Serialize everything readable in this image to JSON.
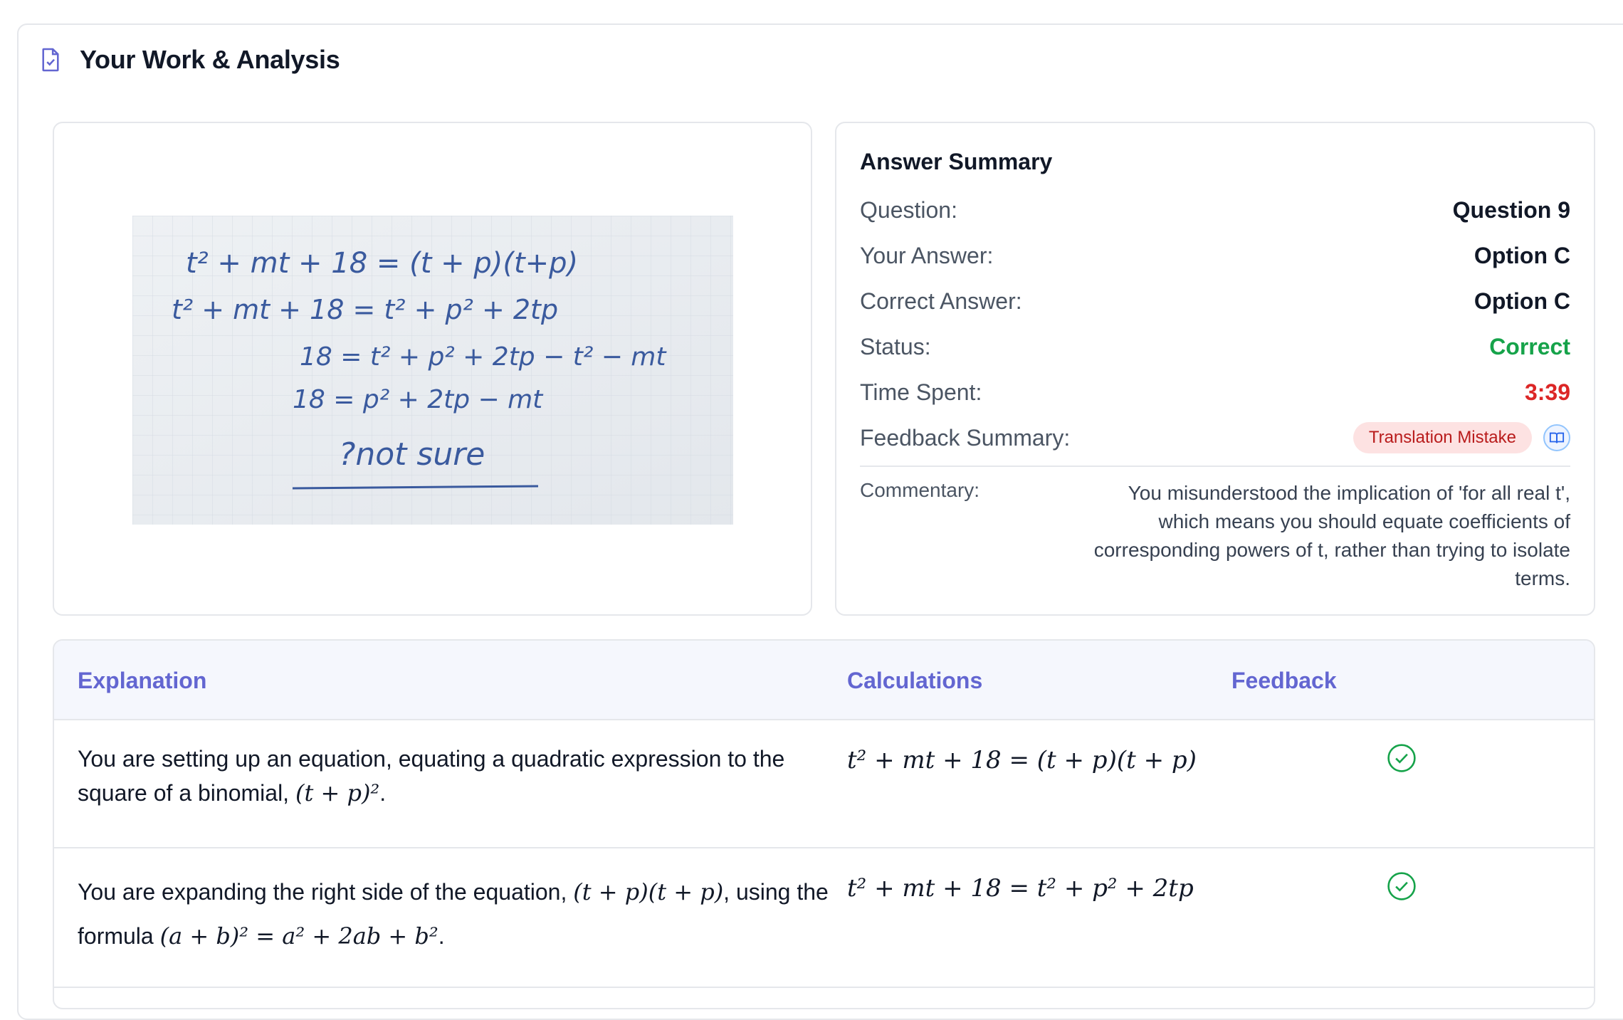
{
  "header": {
    "title": "Your Work & Analysis",
    "icon": "document-check-icon"
  },
  "work": {
    "image_alt": "Handwritten work photo",
    "handwriting": {
      "line1": "t² + mt + 18 = (t + p)(t+p)",
      "line2": "t² + mt + 18 = t² + p² + 2tp",
      "line3": "18 = t² + p² + 2tp − t² − mt",
      "line4": "18 = p² + 2tp − mt",
      "line5": "?not sure"
    }
  },
  "summary": {
    "title": "Answer Summary",
    "question_label": "Question:",
    "question_value": "Question 9",
    "your_answer_label": "Your Answer:",
    "your_answer_value": "Option C",
    "correct_answer_label": "Correct Answer:",
    "correct_answer_value": "Option C",
    "status_label": "Status:",
    "status_value": "Correct",
    "time_label": "Time Spent:",
    "time_value": "3:39",
    "feedback_label": "Feedback Summary:",
    "feedback_badge": "Translation Mistake",
    "commentary_label": "Commentary:",
    "commentary_text": "You misunderstood the implication of 'for all real t', which means you should equate coefficients of corresponding powers of t, rather than trying to isolate terms."
  },
  "table": {
    "headers": {
      "explanation": "Explanation",
      "calculations": "Calculations",
      "feedback": "Feedback"
    },
    "rows": [
      {
        "exp_text": "You are setting up an equation, equating a quadratic expression to the square of a binomial, ",
        "exp_math": "(t + p)²",
        "exp_end": ".",
        "calc": "t² + mt + 18 = (t + p)(t + p)",
        "feedback_icon": "check-circle-icon"
      },
      {
        "exp_text": "You are expanding the right side of the equation, ",
        "exp_math": "(t + p)(t + p)",
        "exp_mid": ", using the formula ",
        "exp_math2": "(a + b)² = a² + 2ab + b²",
        "exp_end": ".",
        "calc": "t² + mt + 18 = t² + p² + 2tp",
        "feedback_icon": "check-circle-icon"
      }
    ]
  },
  "colors": {
    "accent": "#6366d1",
    "correct": "#16a34a",
    "time": "#dc2626",
    "badge_bg": "#fde2e2"
  }
}
